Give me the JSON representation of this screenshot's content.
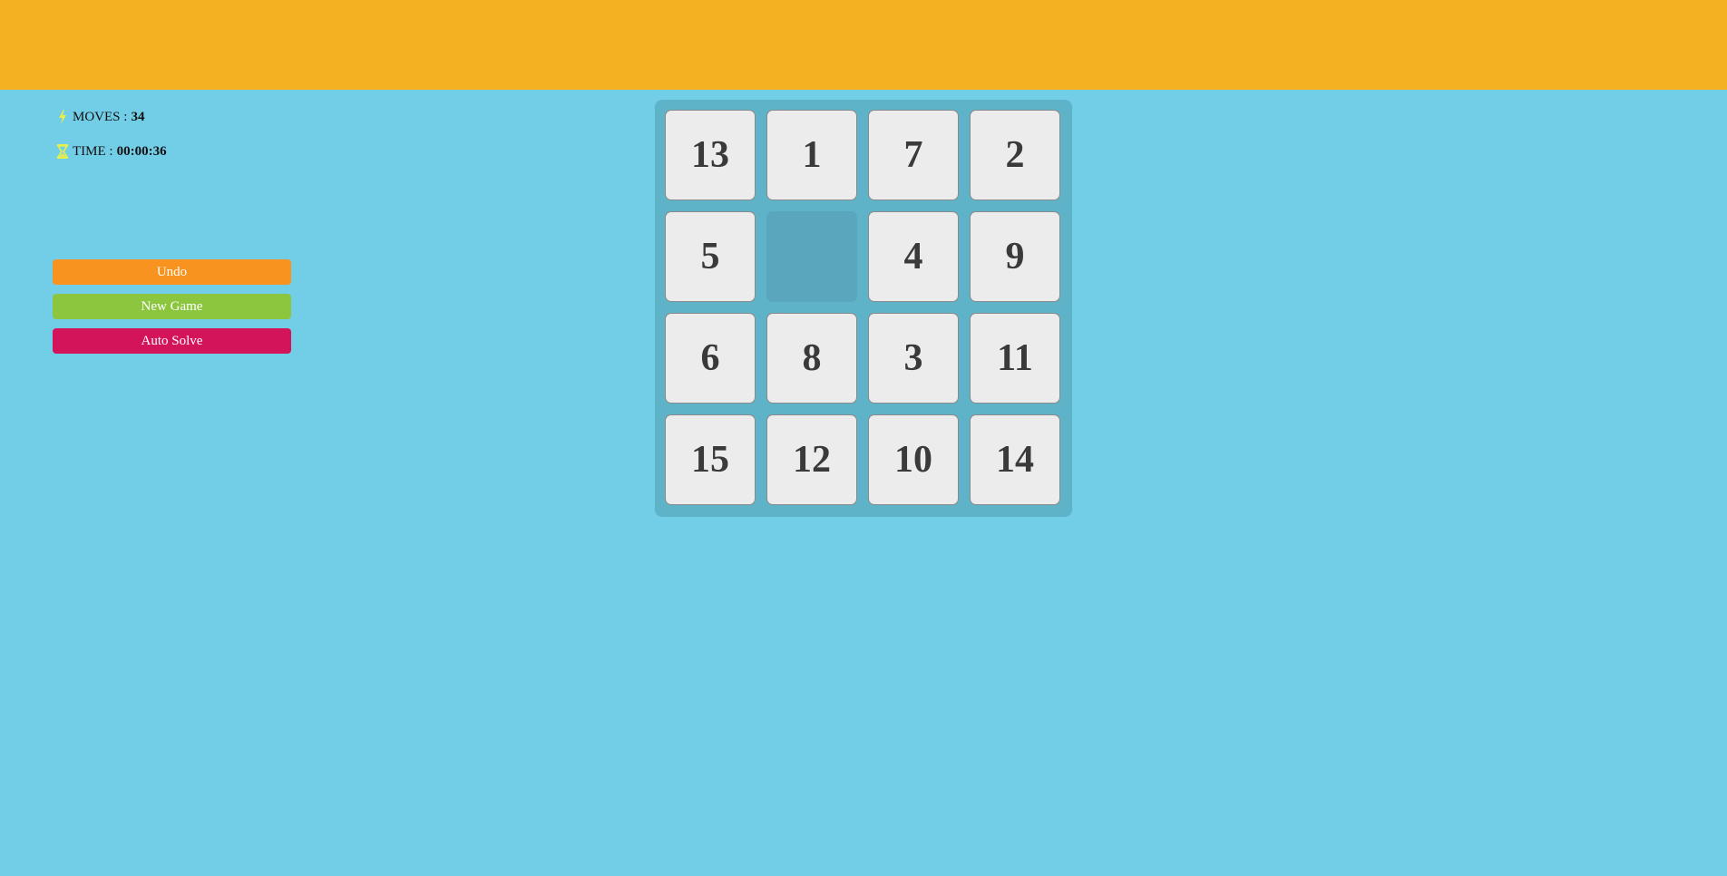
{
  "stats": {
    "moves_label": "MOVES :",
    "moves_value": "34",
    "time_label": "TIME :",
    "time_value": "00:00:36"
  },
  "buttons": {
    "undo": "Undo",
    "new_game": "New Game",
    "auto_solve": "Auto Solve"
  },
  "colors": {
    "banner": "#f4b223",
    "background": "#72cde7",
    "board": "#5fb3c9",
    "undo": "#f7931e",
    "new_game": "#8cc63f",
    "auto_solve": "#d4145a",
    "icon": "#e6f04a"
  },
  "board": {
    "tiles": [
      "13",
      "1",
      "7",
      "2",
      "5",
      "",
      "4",
      "9",
      "6",
      "8",
      "3",
      "11",
      "15",
      "12",
      "10",
      "14"
    ]
  }
}
